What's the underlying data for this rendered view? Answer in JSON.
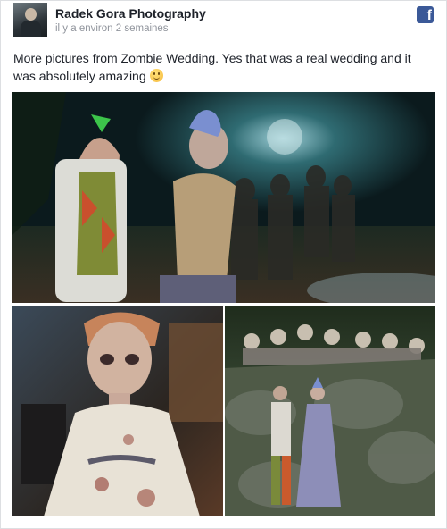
{
  "post": {
    "page_name": "Radek Gora Photography",
    "timestamp": "il y a environ 2 semaines",
    "text": "More pictures from Zombie Wedding. Yes that was a real wedding and it was absolutely amazing",
    "emoji": "smile-emoji",
    "platform_icon": "facebook-icon",
    "photos": [
      {
        "name": "zombie-wedding-couple-photo"
      },
      {
        "name": "zombie-flower-girl-photo"
      },
      {
        "name": "zombie-couple-on-rocks-photo"
      }
    ]
  },
  "colors": {
    "facebook_blue": "#3b5998",
    "text": "#1d2129",
    "meta_text": "#90949c"
  }
}
